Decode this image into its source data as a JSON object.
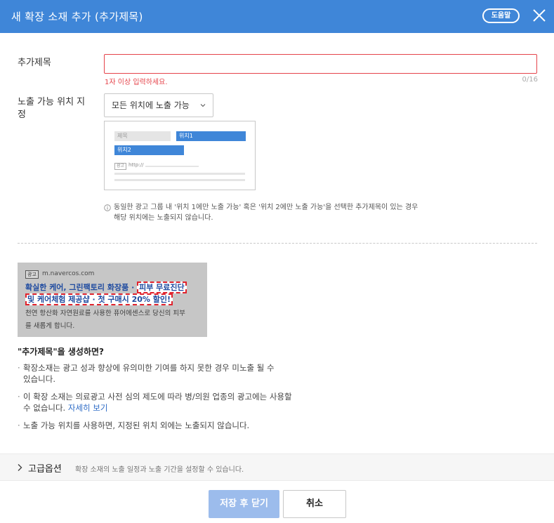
{
  "header": {
    "title": "새 확장 소재 추가 (추가제목)",
    "help_label": "도움말",
    "bg_color": "#3f86d8"
  },
  "form": {
    "title_field": {
      "label": "추가제목",
      "value": "",
      "error": "1자 이상 입력하세요.",
      "counter": "0/16"
    },
    "position_field": {
      "label_line1": "노출 가능 위치 지",
      "label_line2": "정",
      "selected": "모든 위치에 노출 가능"
    },
    "preview": {
      "title_placeholder": "제목",
      "pos1": "위치1",
      "pos2": "위치2",
      "ad_tag": "광고",
      "url": "http://"
    },
    "info": {
      "line1": "동일한 광고 그룹 내 '위치 1에만 노출 가능' 혹은 '위치 2에만 노출 가능'을 선택한 추가제목이 있는 경우",
      "line2": "해당 위치에는 노출되지 않습니다."
    }
  },
  "example": {
    "ad_tag": "광고",
    "domain": "m.navercos.com",
    "headline_part1": "확실한 케어, 그린팩토리 화장품",
    "headline_sep": "·",
    "headline_hl1": "피부 무료진단",
    "headline_hl2": "및 케어체험 제공샵 · 첫 구매시 20% 할인!",
    "desc_line1": "천연 항산화 자연원료를 사용한 퓨어에센스로 당신의 피부",
    "desc_line2": "를 새롭게 합니다."
  },
  "faq": {
    "title": "\"추가제목\"을 생성하면?",
    "bullet1_line1": "확장소재는 광고 성과 향상에 유의미한 기여를 하지 못한 경우 미노출 될 수",
    "bullet1_line2": "있습니다.",
    "bullet2_line1": "이 확장 소재는 의료광고 사전 심의 제도에 따라 병/의원 업종의 광고에는 사용할",
    "bullet2_line2": "수 없습니다.",
    "bullet2_link": "자세히 보기",
    "bullet3": "노출 가능 위치를 사용하면, 지정된 위치 외에는 노출되지 않습니다."
  },
  "advanced": {
    "label": "고급옵션",
    "desc": "확장 소재의 노출 일정과 노출 기간을 설정할 수 있습니다."
  },
  "buttons": {
    "save": "저장 후 닫기",
    "cancel": "취소"
  },
  "colors": {
    "accent": "#3f86d8",
    "error": "#e5434a",
    "save_disabled": "#9cbcec",
    "example_highlight_border": "#e0232d",
    "example_headline": "#1f4ba0"
  },
  "icons": {
    "close": "close-icon",
    "select_chevron": "chevron-down-icon",
    "info": "info-icon",
    "advanced_chevron": "chevron-right-icon"
  }
}
